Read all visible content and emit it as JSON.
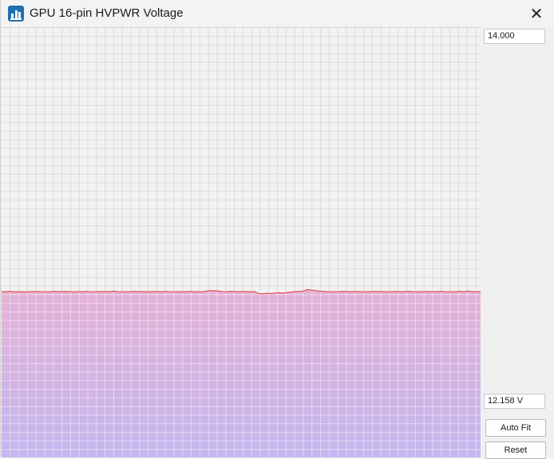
{
  "window": {
    "title": "GPU 16-pin HVPWR Voltage",
    "close_glyph": "✕",
    "icon": "gpu-z-app-icon"
  },
  "scale": {
    "max_label": "14.000",
    "current_label": "12.158 V"
  },
  "buttons": {
    "auto_fit": "Auto Fit",
    "reset": "Reset"
  },
  "colors": {
    "line": "#e8383a",
    "fill_top": "#e4b2d6",
    "fill_bottom": "#c4b6ee",
    "grid": "#dcdcdc",
    "plot_bg": "#f2f2f2"
  },
  "chart_data": {
    "type": "area",
    "ymax": 14.0,
    "ymin": 11.0,
    "values": [
      12.158,
      12.158,
      12.16,
      12.158,
      12.157,
      12.158,
      12.156,
      12.158,
      12.159,
      12.158,
      12.158,
      12.157,
      12.158,
      12.16,
      12.158,
      12.158,
      12.159,
      12.158,
      12.157,
      12.158,
      12.158,
      12.16,
      12.158,
      12.157,
      12.158,
      12.159,
      12.158,
      12.158,
      12.162,
      12.158,
      12.157,
      12.158,
      12.158,
      12.16,
      12.158,
      12.158,
      12.157,
      12.158,
      12.159,
      12.158,
      12.158,
      12.16,
      12.158,
      12.157,
      12.158,
      12.158,
      12.158,
      12.159,
      12.158,
      12.157,
      12.158,
      12.163,
      12.165,
      12.164,
      12.162,
      12.158,
      12.157,
      12.16,
      12.158,
      12.158,
      12.159,
      12.158,
      12.157,
      12.158,
      12.142,
      12.144,
      12.146,
      12.145,
      12.148,
      12.15,
      12.148,
      12.152,
      12.156,
      12.158,
      12.16,
      12.162,
      12.172,
      12.168,
      12.165,
      12.162,
      12.16,
      12.158,
      12.158,
      12.157,
      12.158,
      12.16,
      12.158,
      12.158,
      12.159,
      12.158,
      12.157,
      12.158,
      12.158,
      12.16,
      12.158,
      12.158,
      12.157,
      12.158,
      12.159,
      12.158,
      12.158,
      12.16,
      12.158,
      12.157,
      12.158,
      12.158,
      12.159,
      12.158,
      12.158,
      12.16,
      12.158,
      12.157,
      12.158,
      12.158,
      12.16,
      12.158,
      12.162,
      12.158,
      12.158,
      12.158
    ]
  }
}
